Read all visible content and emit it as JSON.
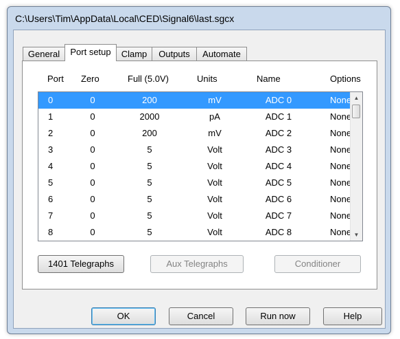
{
  "window": {
    "title": "C:\\Users\\Tim\\AppData\\Local\\CED\\Signal6\\last.sgcx"
  },
  "tabs": [
    {
      "label": "General",
      "active": false
    },
    {
      "label": "Port setup",
      "active": true
    },
    {
      "label": "Clamp",
      "active": false
    },
    {
      "label": "Outputs",
      "active": false
    },
    {
      "label": "Automate",
      "active": false
    }
  ],
  "table": {
    "columns": [
      "Port",
      "Zero",
      "Full (5.0V)",
      "Units",
      "Name",
      "Options"
    ],
    "rows": [
      {
        "port": "0",
        "zero": "0",
        "full": "200",
        "units": "mV",
        "name": "ADC 0",
        "options": "None"
      },
      {
        "port": "1",
        "zero": "0",
        "full": "2000",
        "units": "pA",
        "name": "ADC 1",
        "options": "None"
      },
      {
        "port": "2",
        "zero": "0",
        "full": "200",
        "units": "mV",
        "name": "ADC 2",
        "options": "None"
      },
      {
        "port": "3",
        "zero": "0",
        "full": "5",
        "units": "Volt",
        "name": "ADC 3",
        "options": "None"
      },
      {
        "port": "4",
        "zero": "0",
        "full": "5",
        "units": "Volt",
        "name": "ADC 4",
        "options": "None"
      },
      {
        "port": "5",
        "zero": "0",
        "full": "5",
        "units": "Volt",
        "name": "ADC 5",
        "options": "None"
      },
      {
        "port": "6",
        "zero": "0",
        "full": "5",
        "units": "Volt",
        "name": "ADC 6",
        "options": "None"
      },
      {
        "port": "7",
        "zero": "0",
        "full": "5",
        "units": "Volt",
        "name": "ADC 7",
        "options": "None"
      },
      {
        "port": "8",
        "zero": "0",
        "full": "5",
        "units": "Volt",
        "name": "ADC 8",
        "options": "None"
      }
    ],
    "selected_row": 0,
    "scrollbar": {
      "up_icon": "scroll-up-arrow-icon",
      "down_icon": "scroll-down-arrow-icon"
    }
  },
  "panel_buttons": {
    "telegraphs": "1401 Telegraphs",
    "aux_telegraphs": "Aux Telegraphs",
    "conditioner": "Conditioner"
  },
  "footer_buttons": {
    "ok": "OK",
    "cancel": "Cancel",
    "run_now": "Run now",
    "help": "Help"
  },
  "colors": {
    "selection": "#3399ff",
    "frame": "#c9d9ec",
    "disabled_text": "#838383"
  }
}
